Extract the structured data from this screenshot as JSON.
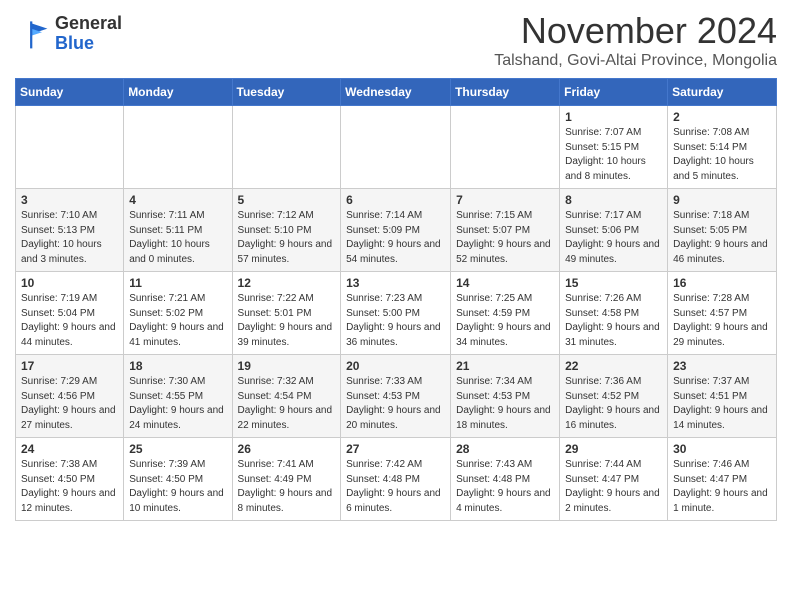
{
  "header": {
    "logo_general": "General",
    "logo_blue": "Blue",
    "month_title": "November 2024",
    "subtitle": "Talshand, Govi-Altai Province, Mongolia"
  },
  "weekdays": [
    "Sunday",
    "Monday",
    "Tuesday",
    "Wednesday",
    "Thursday",
    "Friday",
    "Saturday"
  ],
  "weeks": [
    [
      {
        "day": "",
        "info": ""
      },
      {
        "day": "",
        "info": ""
      },
      {
        "day": "",
        "info": ""
      },
      {
        "day": "",
        "info": ""
      },
      {
        "day": "",
        "info": ""
      },
      {
        "day": "1",
        "info": "Sunrise: 7:07 AM\nSunset: 5:15 PM\nDaylight: 10 hours and 8 minutes."
      },
      {
        "day": "2",
        "info": "Sunrise: 7:08 AM\nSunset: 5:14 PM\nDaylight: 10 hours and 5 minutes."
      }
    ],
    [
      {
        "day": "3",
        "info": "Sunrise: 7:10 AM\nSunset: 5:13 PM\nDaylight: 10 hours and 3 minutes."
      },
      {
        "day": "4",
        "info": "Sunrise: 7:11 AM\nSunset: 5:11 PM\nDaylight: 10 hours and 0 minutes."
      },
      {
        "day": "5",
        "info": "Sunrise: 7:12 AM\nSunset: 5:10 PM\nDaylight: 9 hours and 57 minutes."
      },
      {
        "day": "6",
        "info": "Sunrise: 7:14 AM\nSunset: 5:09 PM\nDaylight: 9 hours and 54 minutes."
      },
      {
        "day": "7",
        "info": "Sunrise: 7:15 AM\nSunset: 5:07 PM\nDaylight: 9 hours and 52 minutes."
      },
      {
        "day": "8",
        "info": "Sunrise: 7:17 AM\nSunset: 5:06 PM\nDaylight: 9 hours and 49 minutes."
      },
      {
        "day": "9",
        "info": "Sunrise: 7:18 AM\nSunset: 5:05 PM\nDaylight: 9 hours and 46 minutes."
      }
    ],
    [
      {
        "day": "10",
        "info": "Sunrise: 7:19 AM\nSunset: 5:04 PM\nDaylight: 9 hours and 44 minutes."
      },
      {
        "day": "11",
        "info": "Sunrise: 7:21 AM\nSunset: 5:02 PM\nDaylight: 9 hours and 41 minutes."
      },
      {
        "day": "12",
        "info": "Sunrise: 7:22 AM\nSunset: 5:01 PM\nDaylight: 9 hours and 39 minutes."
      },
      {
        "day": "13",
        "info": "Sunrise: 7:23 AM\nSunset: 5:00 PM\nDaylight: 9 hours and 36 minutes."
      },
      {
        "day": "14",
        "info": "Sunrise: 7:25 AM\nSunset: 4:59 PM\nDaylight: 9 hours and 34 minutes."
      },
      {
        "day": "15",
        "info": "Sunrise: 7:26 AM\nSunset: 4:58 PM\nDaylight: 9 hours and 31 minutes."
      },
      {
        "day": "16",
        "info": "Sunrise: 7:28 AM\nSunset: 4:57 PM\nDaylight: 9 hours and 29 minutes."
      }
    ],
    [
      {
        "day": "17",
        "info": "Sunrise: 7:29 AM\nSunset: 4:56 PM\nDaylight: 9 hours and 27 minutes."
      },
      {
        "day": "18",
        "info": "Sunrise: 7:30 AM\nSunset: 4:55 PM\nDaylight: 9 hours and 24 minutes."
      },
      {
        "day": "19",
        "info": "Sunrise: 7:32 AM\nSunset: 4:54 PM\nDaylight: 9 hours and 22 minutes."
      },
      {
        "day": "20",
        "info": "Sunrise: 7:33 AM\nSunset: 4:53 PM\nDaylight: 9 hours and 20 minutes."
      },
      {
        "day": "21",
        "info": "Sunrise: 7:34 AM\nSunset: 4:53 PM\nDaylight: 9 hours and 18 minutes."
      },
      {
        "day": "22",
        "info": "Sunrise: 7:36 AM\nSunset: 4:52 PM\nDaylight: 9 hours and 16 minutes."
      },
      {
        "day": "23",
        "info": "Sunrise: 7:37 AM\nSunset: 4:51 PM\nDaylight: 9 hours and 14 minutes."
      }
    ],
    [
      {
        "day": "24",
        "info": "Sunrise: 7:38 AM\nSunset: 4:50 PM\nDaylight: 9 hours and 12 minutes."
      },
      {
        "day": "25",
        "info": "Sunrise: 7:39 AM\nSunset: 4:50 PM\nDaylight: 9 hours and 10 minutes."
      },
      {
        "day": "26",
        "info": "Sunrise: 7:41 AM\nSunset: 4:49 PM\nDaylight: 9 hours and 8 minutes."
      },
      {
        "day": "27",
        "info": "Sunrise: 7:42 AM\nSunset: 4:48 PM\nDaylight: 9 hours and 6 minutes."
      },
      {
        "day": "28",
        "info": "Sunrise: 7:43 AM\nSunset: 4:48 PM\nDaylight: 9 hours and 4 minutes."
      },
      {
        "day": "29",
        "info": "Sunrise: 7:44 AM\nSunset: 4:47 PM\nDaylight: 9 hours and 2 minutes."
      },
      {
        "day": "30",
        "info": "Sunrise: 7:46 AM\nSunset: 4:47 PM\nDaylight: 9 hours and 1 minute."
      }
    ]
  ]
}
